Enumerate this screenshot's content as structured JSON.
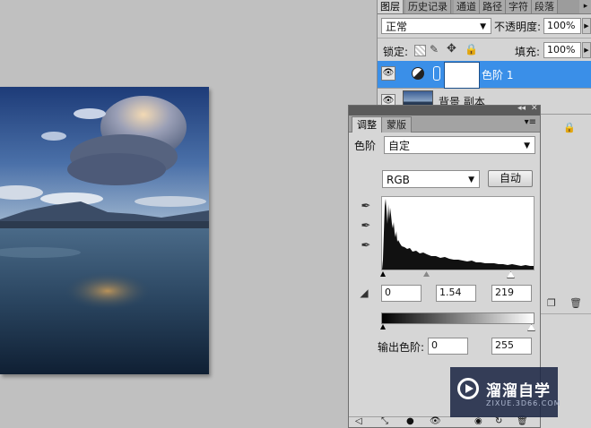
{
  "layers_panel": {
    "tabs": [
      "图层",
      "历史记录",
      "通道",
      "路径",
      "字符",
      "段落"
    ],
    "blend_mode": "正常",
    "opacity_label": "不透明度:",
    "opacity_value": "100%",
    "lock_label": "锁定:",
    "fill_label": "填充:",
    "fill_value": "100%",
    "layers": [
      {
        "name": "色阶 1",
        "selected": true
      },
      {
        "name": "背景 副本",
        "selected": false
      }
    ]
  },
  "adjustments_panel": {
    "tabs": [
      "调整",
      "蒙版"
    ],
    "title_label": "色阶",
    "preset_value": "自定",
    "channel_value": "RGB",
    "auto_button": "自动",
    "input_black": "0",
    "input_gamma": "1.54",
    "input_white": "219",
    "output_label": "输出色阶:",
    "output_black": "0",
    "output_white": "255"
  },
  "watermark": {
    "brand": "溜溜自学",
    "url": "ZIXUE.3D66.COM"
  },
  "colors": {
    "selection": "#3a8fe8",
    "panel_bg": "#d6d6d6",
    "workspace": "#c0c0c0"
  }
}
